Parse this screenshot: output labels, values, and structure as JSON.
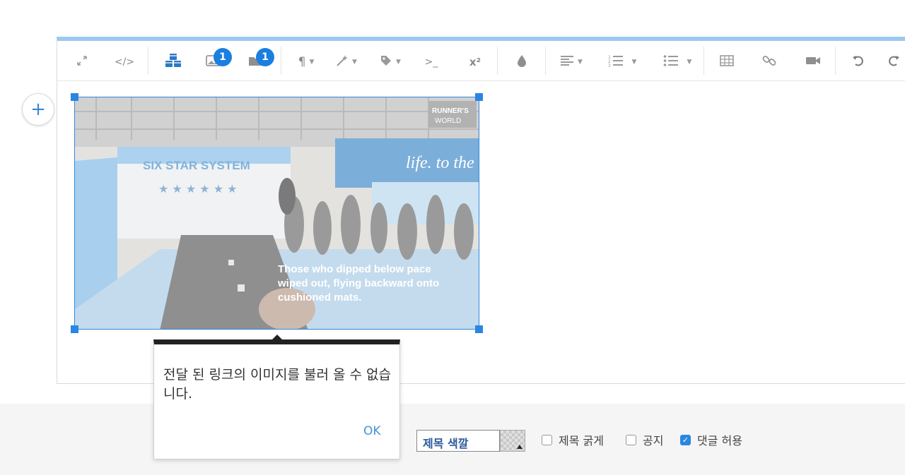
{
  "toolbar": {
    "fullscreen_icon": "expand-icon",
    "code_label": "</>",
    "badge_image": "1",
    "badge_video": "1",
    "subscript_label": ">_",
    "superscript_label": "x²",
    "colors": {
      "accent": "#1a7fe0",
      "top_border": "#9cc9f0"
    }
  },
  "add_button_label": "+",
  "image": {
    "brand_line1": "RUNNER'S",
    "brand_line2": "WORLD",
    "banner_title": "SIX STAR SYSTEM",
    "right_banner": "life. to the",
    "caption_line1": "Those who dipped below pace",
    "caption_line2": "wiped out, flying backward onto",
    "caption_line3": "cushioned mats."
  },
  "dialog": {
    "message": "전달 된 링크의 이미지를 불러 올 수 없습니다.",
    "ok_label": "OK"
  },
  "footer": {
    "title_color_label": "제목 색깔",
    "bold_title_label": "제목 굵게",
    "bold_title_checked": false,
    "notice_label": "공지",
    "notice_checked": false,
    "allow_comments_label": "댓글 허용",
    "allow_comments_checked": true
  }
}
